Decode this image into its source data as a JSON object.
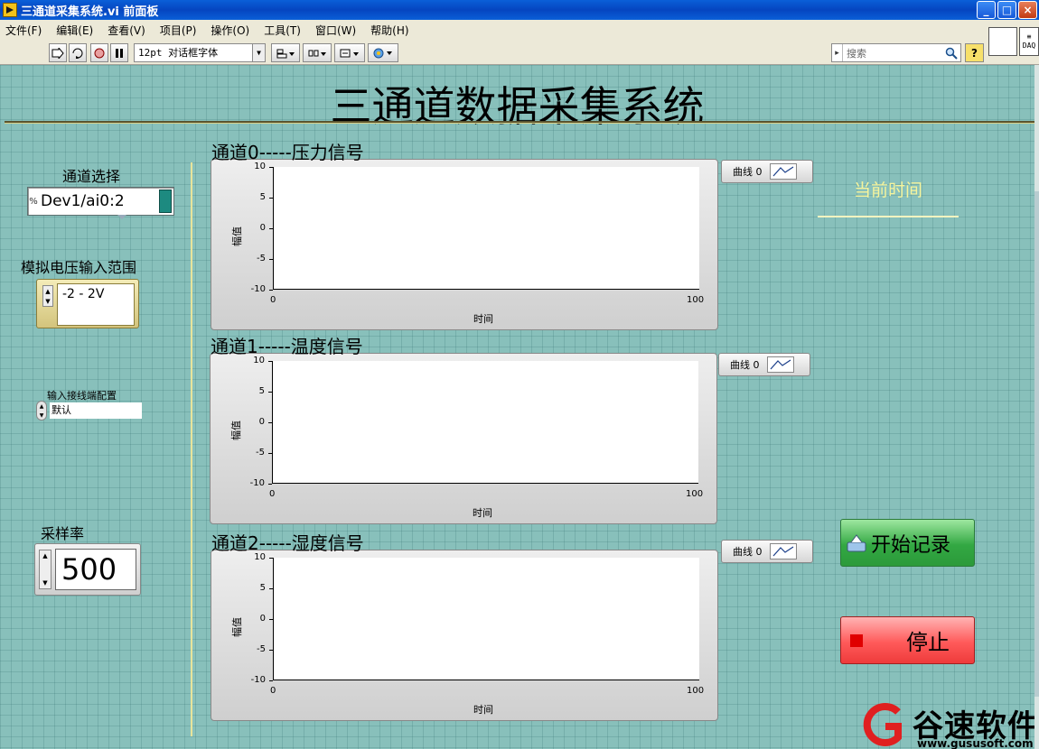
{
  "window": {
    "title": "三通道采集系统.vi 前面板",
    "buttons": {
      "minimize": "_",
      "maximize": "□",
      "close": "×"
    }
  },
  "menu": [
    "文件(F)",
    "编辑(E)",
    "查看(V)",
    "项目(P)",
    "操作(O)",
    "工具(T)",
    "窗口(W)",
    "帮助(H)"
  ],
  "toolbar": {
    "font": "12pt 对话框字体",
    "search_placeholder": "搜索",
    "help": "?",
    "daq_icon": "DAQ"
  },
  "panel": {
    "headline": "三通道数据采集系统",
    "channel_select": {
      "label": "通道选择",
      "prefix": "%",
      "value": "Dev1/ai0:2"
    },
    "voltage_range": {
      "label": "模拟电压输入范围",
      "value": "-2 -  2V"
    },
    "terminal_config": {
      "label": "输入接线端配置",
      "value": "默认"
    },
    "sample_rate": {
      "label": "采样率",
      "value": "500"
    },
    "current_time": {
      "label": "当前时间"
    },
    "start_button": "开始记录",
    "stop_button": "停止"
  },
  "graphs": [
    {
      "title": "通道0-----压力信号",
      "xlabel": "时间",
      "ylabel": "幅值",
      "legend": "曲线 0"
    },
    {
      "title": "通道1-----温度信号",
      "xlabel": "时间",
      "ylabel": "幅值",
      "legend": "曲线 0"
    },
    {
      "title": "通道2-----湿度信号",
      "xlabel": "时间",
      "ylabel": "幅值",
      "legend": "曲线 0"
    }
  ],
  "chart_data": [
    {
      "type": "line",
      "title": "通道0-----压力信号",
      "xlabel": "时间",
      "ylabel": "幅值",
      "xlim": [
        0,
        100
      ],
      "ylim": [
        -10,
        10
      ],
      "yticks": [
        "10",
        "5",
        "0",
        "-5",
        "-10"
      ],
      "xticks": [
        "0",
        "100"
      ],
      "series": [
        {
          "name": "曲线 0",
          "values": []
        }
      ]
    },
    {
      "type": "line",
      "title": "通道1-----温度信号",
      "xlabel": "时间",
      "ylabel": "幅值",
      "xlim": [
        0,
        100
      ],
      "ylim": [
        -10,
        10
      ],
      "yticks": [
        "10",
        "5",
        "0",
        "-5",
        "-10"
      ],
      "xticks": [
        "0",
        "100"
      ],
      "series": [
        {
          "name": "曲线 0",
          "values": []
        }
      ]
    },
    {
      "type": "line",
      "title": "通道2-----湿度信号",
      "xlabel": "时间",
      "ylabel": "幅值",
      "xlim": [
        0,
        100
      ],
      "ylim": [
        -10,
        10
      ],
      "yticks": [
        "10",
        "5",
        "0",
        "-5",
        "-10"
      ],
      "xticks": [
        "0",
        "100"
      ],
      "series": [
        {
          "name": "曲线 0",
          "values": []
        }
      ]
    }
  ],
  "watermark": {
    "name": "谷速软件",
    "url": "www.gususoft.com"
  }
}
